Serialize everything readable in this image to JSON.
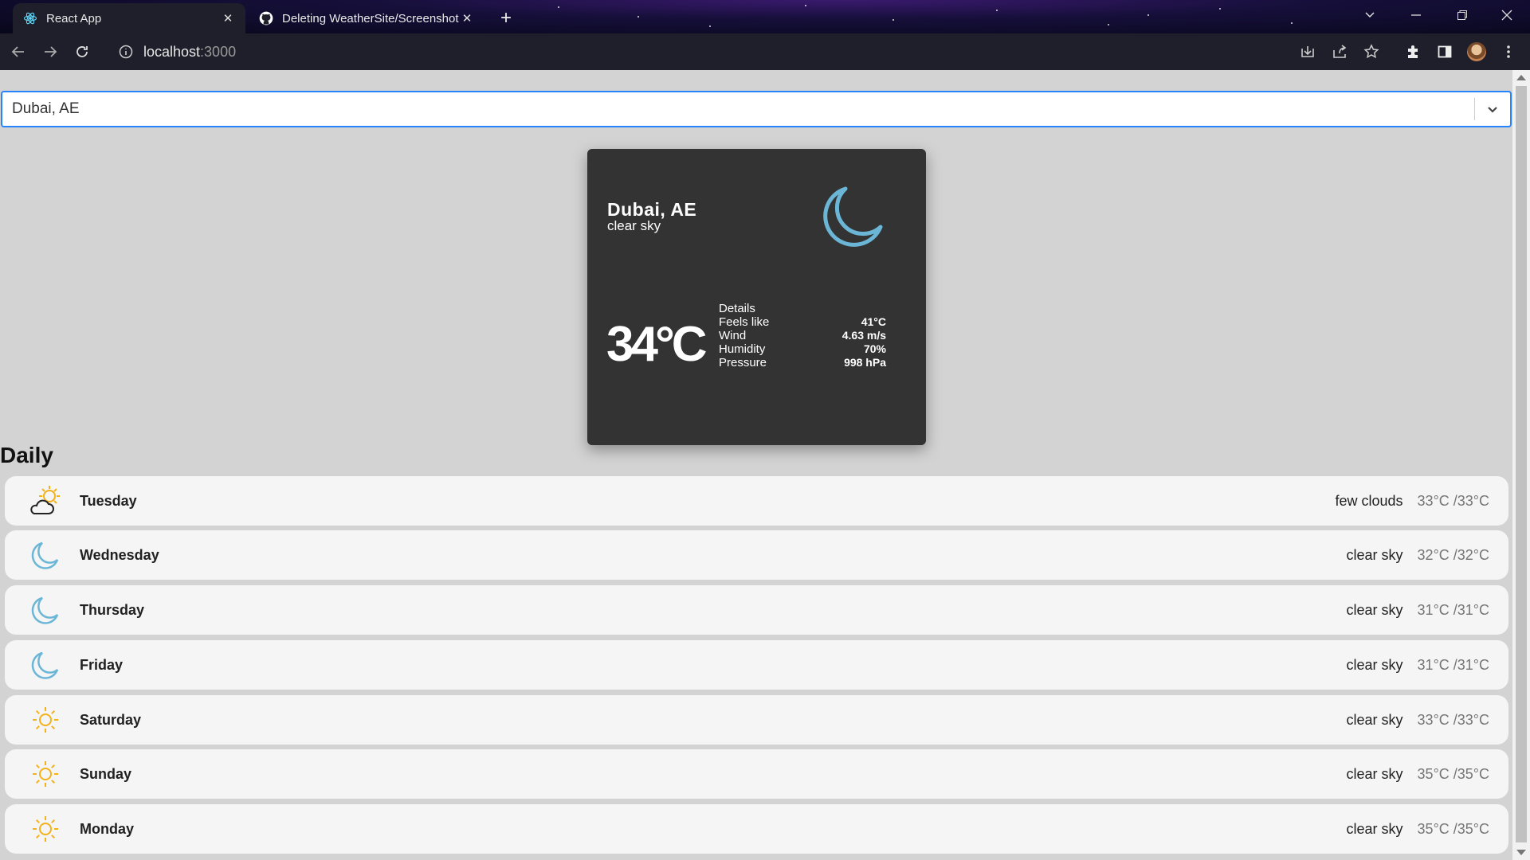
{
  "browser": {
    "tabs": [
      {
        "title": "React App",
        "icon": "react-icon",
        "active": true
      },
      {
        "title": "Deleting WeatherSite/Screenshot",
        "icon": "github-icon",
        "active": false
      }
    ],
    "url_host": "localhost",
    "url_port": ":3000"
  },
  "search": {
    "value": "Dubai, AE"
  },
  "current": {
    "city": "Dubai, AE",
    "description": "clear sky",
    "temperature": "34°C",
    "icon": "moon-icon",
    "details_label": "Details",
    "details": [
      {
        "label": "Feels like",
        "value": "41°C"
      },
      {
        "label": "Wind",
        "value": "4.63 m/s"
      },
      {
        "label": "Humidity",
        "value": "70%"
      },
      {
        "label": "Pressure",
        "value": "998 hPa"
      }
    ]
  },
  "daily": {
    "title": "Daily",
    "days": [
      {
        "day": "Tuesday",
        "description": "few clouds",
        "temp": "33°C /33°C",
        "icon": "partly-cloudy-icon"
      },
      {
        "day": "Wednesday",
        "description": "clear sky",
        "temp": "32°C /32°C",
        "icon": "moon-icon"
      },
      {
        "day": "Thursday",
        "description": "clear sky",
        "temp": "31°C /31°C",
        "icon": "moon-icon"
      },
      {
        "day": "Friday",
        "description": "clear sky",
        "temp": "31°C /31°C",
        "icon": "moon-icon"
      },
      {
        "day": "Saturday",
        "description": "clear sky",
        "temp": "33°C /33°C",
        "icon": "sun-icon"
      },
      {
        "day": "Sunday",
        "description": "clear sky",
        "temp": "35°C /35°C",
        "icon": "sun-icon"
      },
      {
        "day": "Monday",
        "description": "clear sky",
        "temp": "35°C /35°C",
        "icon": "sun-icon"
      }
    ]
  },
  "colors": {
    "moon": "#6bb6d6",
    "sun": "#f3b21a",
    "card": "#333333",
    "focus": "#2684ff"
  }
}
